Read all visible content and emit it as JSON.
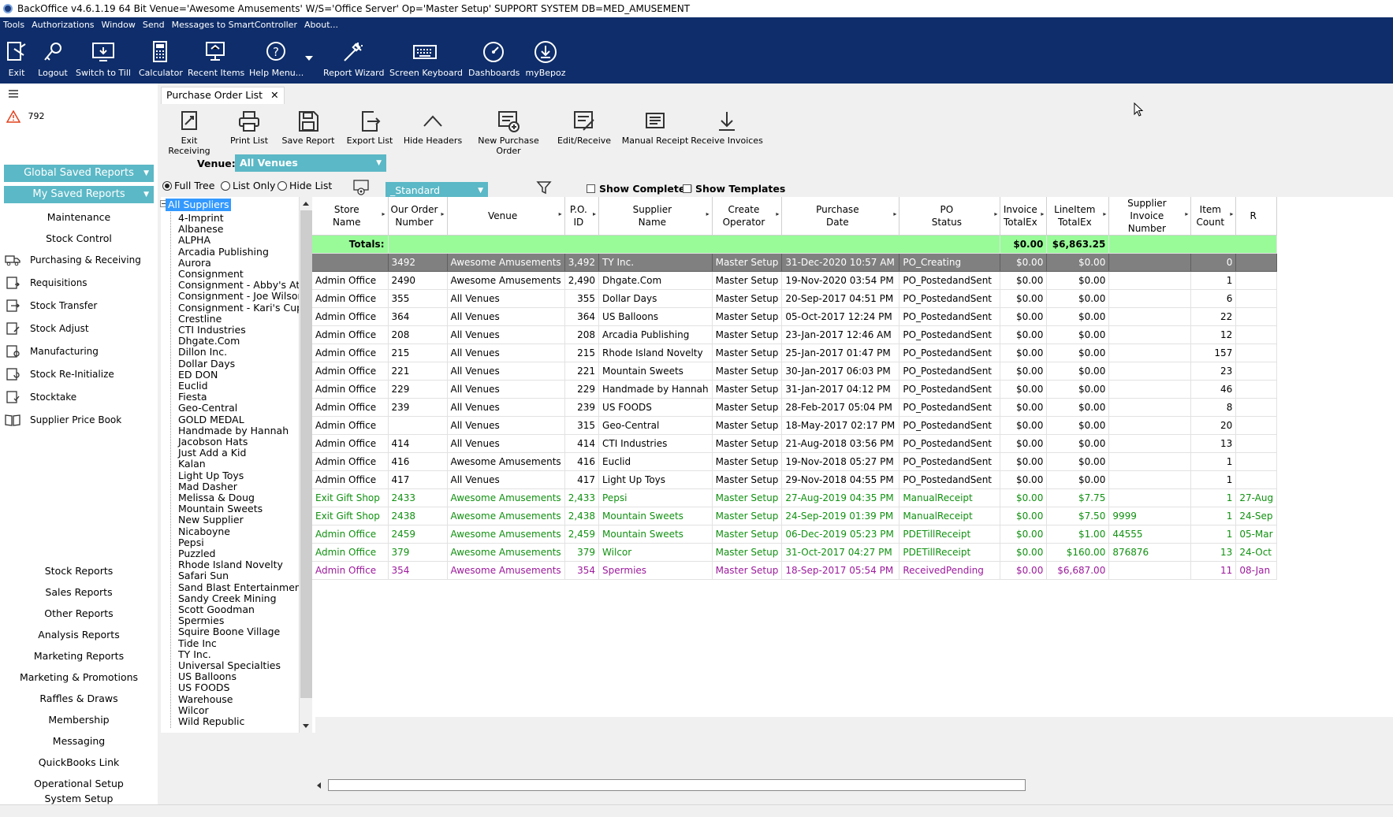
{
  "window": {
    "title": "BackOffice v4.6.1.19 64 Bit Venue='Awesome Amusements' W/S='Office Server'  Op='Master Setup'  SUPPORT SYSTEM DB=MED_AMUSEMENT"
  },
  "menu": [
    "Tools",
    "Authorizations",
    "Window",
    "Send",
    "Messages to SmartController",
    "About..."
  ],
  "toolbar": {
    "exit": "Exit",
    "logout": "Logout",
    "switch_to_till": "Switch to Till",
    "calculator": "Calculator",
    "recent_items": "Recent Items",
    "help_menu": "Help Menu...",
    "report_wizard": "Report Wizard",
    "screen_keyboard": "Screen Keyboard",
    "dashboards": "Dashboards",
    "mybepoz": "myBepoz"
  },
  "sidebar": {
    "alert_count": "792",
    "global_saved_reports": "Global Saved Reports",
    "my_saved_reports": "My Saved Reports",
    "maintenance": "Maintenance",
    "stock_control": "Stock Control",
    "stock_items": [
      "Purchasing & Receiving",
      "Requisitions",
      "Stock Transfer",
      "Stock Adjust",
      "Manufacturing",
      "Stock Re-Initialize",
      "Stocktake",
      "Supplier Price Book"
    ],
    "reports": [
      "Stock Reports",
      "Sales Reports",
      "Other Reports",
      "Analysis Reports",
      "Marketing Reports",
      "Marketing & Promotions",
      "Raffles & Draws",
      "Membership",
      "Messaging",
      "QuickBooks Link",
      "Operational Setup",
      "System Setup"
    ]
  },
  "tab": {
    "label": "Purchase Order List",
    "close": "✕"
  },
  "actions": {
    "exit_receiving": "Exit Receiving",
    "print_list": "Print List",
    "save_report": "Save Report",
    "export_list": "Export List",
    "hide_headers": "Hide Headers",
    "new_po": "New Purchase Order",
    "edit_receive": "Edit/Receive",
    "manual_receipt": "Manual Receipt",
    "receive_invoices": "Receive Invoices"
  },
  "filters": {
    "venue_label": "Venue:",
    "venue_value": "All Venues",
    "full_tree": "Full Tree",
    "list_only": "List Only",
    "hide_list": "Hide List",
    "layout_value": "_Standard",
    "show_completed": "Show Completed",
    "show_templates": "Show Templates"
  },
  "tree": {
    "root": "All Suppliers",
    "items": [
      "4-Imprint",
      "Albanese",
      "ALPHA",
      "Arcadia Publishing",
      "Aurora",
      "Consignment",
      "Consignment - Abby's Attic",
      "Consignment - Joe Wilson",
      "Consignment - Kari's Cups",
      "Crestline",
      "CTI Industries",
      "Dhgate.Com",
      "Dillon Inc.",
      "Dollar Days",
      "ED DON",
      "Euclid",
      "Fiesta",
      "Geo-Central",
      "GOLD MEDAL",
      "Handmade by Hannah",
      "Jacobson Hats",
      "Just Add a Kid",
      "Kalan",
      "Light Up Toys",
      "Mad Dasher",
      "Melissa & Doug",
      "Mountain Sweets",
      "New Supplier",
      "Nicaboyne",
      "Pepsi",
      "Puzzled",
      "Rhode Island Novelty",
      "Safari Sun",
      "Sand Blast Entertainment",
      "Sandy Creek Mining",
      "Scott Goodman",
      "Spermies",
      "Squire Boone Village",
      "Tide Inc",
      "TY Inc.",
      "Universal Specialties",
      "US Balloons",
      "US FOODS",
      "Warehouse",
      "Wilcor",
      "Wild Republic"
    ]
  },
  "grid": {
    "columns": [
      "Store\nName",
      "Our Order\nNumber",
      "Venue",
      "P.O.\nID",
      "Supplier\nName",
      "Create\nOperator",
      "Purchase\nDate",
      "PO\nStatus",
      "Invoice\nTotalEx",
      "LineItem\nTotalEx",
      "Supplier\nInvoice Number",
      "Item\nCount",
      "R"
    ],
    "totals_label": "Totals:",
    "totals_invoice": "$0.00",
    "totals_lineitem": "$6,863.25",
    "rows": [
      {
        "style": "selected",
        "cells": [
          "",
          "3492",
          "Awesome Amusements",
          "3,492",
          "TY Inc.",
          "Master Setup",
          "31-Dec-2020 10:57 AM",
          "PO_Creating",
          "$0.00",
          "$0.00",
          "",
          "0",
          ""
        ]
      },
      {
        "style": "normal",
        "cells": [
          "Admin Office",
          "2490",
          "Awesome Amusements",
          "2,490",
          "Dhgate.Com",
          "Master Setup",
          "19-Nov-2020 03:54 PM",
          "PO_PostedandSent",
          "$0.00",
          "$0.00",
          "",
          "1",
          ""
        ]
      },
      {
        "style": "normal",
        "cells": [
          "Admin Office",
          "355",
          "All Venues",
          "355",
          "Dollar Days",
          "Master Setup",
          "20-Sep-2017 04:51 PM",
          "PO_PostedandSent",
          "$0.00",
          "$0.00",
          "",
          "6",
          ""
        ]
      },
      {
        "style": "normal",
        "cells": [
          "Admin Office",
          "364",
          "All Venues",
          "364",
          "US Balloons",
          "Master Setup",
          "05-Oct-2017 12:24 PM",
          "PO_PostedandSent",
          "$0.00",
          "$0.00",
          "",
          "22",
          ""
        ]
      },
      {
        "style": "normal",
        "cells": [
          "Admin Office",
          "208",
          "All Venues",
          "208",
          "Arcadia Publishing",
          "Master Setup",
          "23-Jan-2017 12:46 AM",
          "PO_PostedandSent",
          "$0.00",
          "$0.00",
          "",
          "12",
          ""
        ]
      },
      {
        "style": "normal",
        "cells": [
          "Admin Office",
          "215",
          "All Venues",
          "215",
          "Rhode Island Novelty",
          "Master Setup",
          "25-Jan-2017 01:47 PM",
          "PO_PostedandSent",
          "$0.00",
          "$0.00",
          "",
          "157",
          ""
        ]
      },
      {
        "style": "normal",
        "cells": [
          "Admin Office",
          "221",
          "All Venues",
          "221",
          "Mountain Sweets",
          "Master Setup",
          "30-Jan-2017 06:03 PM",
          "PO_PostedandSent",
          "$0.00",
          "$0.00",
          "",
          "23",
          ""
        ]
      },
      {
        "style": "normal",
        "cells": [
          "Admin Office",
          "229",
          "All Venues",
          "229",
          "Handmade by Hannah",
          "Master Setup",
          "31-Jan-2017 04:12 PM",
          "PO_PostedandSent",
          "$0.00",
          "$0.00",
          "",
          "46",
          ""
        ]
      },
      {
        "style": "normal",
        "cells": [
          "Admin Office",
          "239",
          "All Venues",
          "239",
          "US FOODS",
          "Master Setup",
          "28-Feb-2017 05:04 PM",
          "PO_PostedandSent",
          "$0.00",
          "$0.00",
          "",
          "8",
          ""
        ]
      },
      {
        "style": "normal",
        "cells": [
          "Admin Office",
          "",
          "All Venues",
          "315",
          "Geo-Central",
          "Master Setup",
          "18-May-2017 02:17 PM",
          "PO_PostedandSent",
          "$0.00",
          "$0.00",
          "",
          "20",
          ""
        ]
      },
      {
        "style": "normal",
        "cells": [
          "Admin Office",
          "414",
          "All Venues",
          "414",
          "CTI Industries",
          "Master Setup",
          "21-Aug-2018 03:56 PM",
          "PO_PostedandSent",
          "$0.00",
          "$0.00",
          "",
          "13",
          ""
        ]
      },
      {
        "style": "normal",
        "cells": [
          "Admin Office",
          "416",
          "Awesome Amusements",
          "416",
          "Euclid",
          "Master Setup",
          "19-Nov-2018 05:27 PM",
          "PO_PostedandSent",
          "$0.00",
          "$0.00",
          "",
          "1",
          ""
        ]
      },
      {
        "style": "normal",
        "cells": [
          "Admin Office",
          "417",
          "All Venues",
          "417",
          "Light Up Toys",
          "Master Setup",
          "29-Nov-2018 04:55 PM",
          "PO_PostedandSent",
          "$0.00",
          "$0.00",
          "",
          "1",
          ""
        ]
      },
      {
        "style": "green",
        "cells": [
          "Exit Gift Shop",
          "2433",
          "Awesome Amusements",
          "2,433",
          "Pepsi",
          "Master Setup",
          "27-Aug-2019 04:35 PM",
          "ManualReceipt",
          "$0.00",
          "$7.75",
          "",
          "1",
          "27-Aug"
        ]
      },
      {
        "style": "green",
        "cells": [
          "Exit Gift Shop",
          "2438",
          "Awesome Amusements",
          "2,438",
          "Mountain Sweets",
          "Master Setup",
          "24-Sep-2019 01:39 PM",
          "ManualReceipt",
          "$0.00",
          "$7.50",
          "9999",
          "1",
          "24-Sep"
        ]
      },
      {
        "style": "green",
        "cells": [
          "Admin Office",
          "2459",
          "Awesome Amusements",
          "2,459",
          "Mountain Sweets",
          "Master Setup",
          "06-Dec-2019 05:23 PM",
          "PDETillReceipt",
          "$0.00",
          "$1.00",
          "44555",
          "1",
          "05-Mar"
        ]
      },
      {
        "style": "green",
        "cells": [
          "Admin Office",
          "379",
          "Awesome Amusements",
          "379",
          "Wilcor",
          "Master Setup",
          "31-Oct-2017 04:27 PM",
          "PDETillReceipt",
          "$0.00",
          "$160.00",
          "876876",
          "13",
          "24-Oct"
        ]
      },
      {
        "style": "purple",
        "cells": [
          "Admin Office",
          "354",
          "Awesome Amusements",
          "354",
          "Spermies",
          "Master Setup",
          "18-Sep-2017 05:54 PM",
          "ReceivedPending",
          "$0.00",
          "$6,687.00",
          "",
          "11",
          "08-Jan"
        ]
      }
    ]
  }
}
